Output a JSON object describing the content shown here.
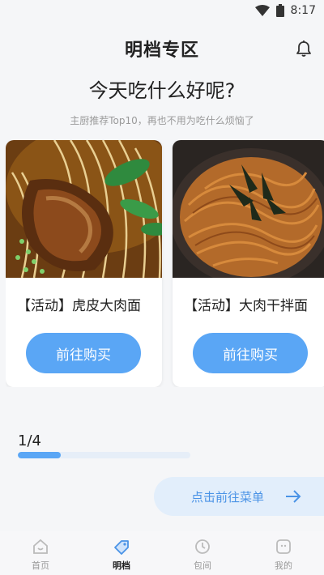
{
  "status_bar": {
    "time": "8:17",
    "wifi_icon": "wifi-icon",
    "battery_icon": "battery-icon"
  },
  "header": {
    "title": "明档专区",
    "bell_icon": "bell-icon"
  },
  "headline": "今天吃什么好呢?",
  "subline": "主厨推荐Top10，再也不用为吃什么烦恼了",
  "cards": [
    {
      "title": "【活动】虎皮大肉面",
      "button_label": "前往购买",
      "image": "braised-pork-noodle-photo"
    },
    {
      "title": "【活动】大肉干拌面",
      "button_label": "前往购买",
      "image": "dry-mixed-noodle-photo"
    }
  ],
  "pager": {
    "text": "1/4",
    "progress": 0.25
  },
  "menu_link": {
    "label": "点击前往菜单",
    "icon": "arrow-right-icon"
  },
  "tabs": [
    {
      "label": "首页",
      "icon": "home-icon",
      "active": false
    },
    {
      "label": "明档",
      "icon": "tag-icon",
      "active": true
    },
    {
      "label": "包间",
      "icon": "clock-icon",
      "active": false
    },
    {
      "label": "我的",
      "icon": "profile-icon",
      "active": false
    }
  ],
  "colors": {
    "accent": "#5aa6f5",
    "accent_light": "#e2eefb",
    "background": "#f5f6f8"
  }
}
